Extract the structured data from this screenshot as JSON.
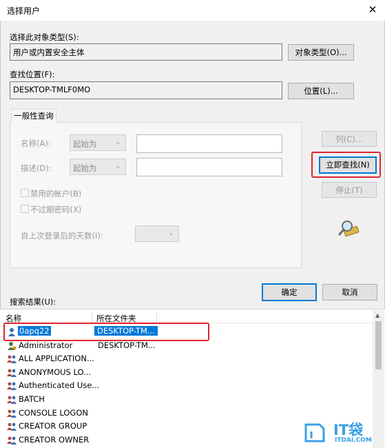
{
  "window": {
    "title": "选择用户",
    "close_glyph": "✕"
  },
  "object_type": {
    "label": "选择此对象类型(S):",
    "value": "用户或内置安全主体",
    "button": "对象类型(O)..."
  },
  "location": {
    "label": "查找位置(F):",
    "value": "DESKTOP-TMLF0MO",
    "button": "位置(L)..."
  },
  "tab": {
    "label": "一般性查询"
  },
  "query": {
    "name_label": "名称(A):",
    "name_combo": "起始为",
    "desc_label": "描述(D):",
    "desc_combo": "起始为",
    "disabled_accounts": "禁用的帐户(B)",
    "non_expiring_password": "不过期密码(X)",
    "days_since_logon": "自上次登录后的天数(I):"
  },
  "side_buttons": {
    "columns": "列(C)...",
    "find_now": "立即查找(N)",
    "stop": "停止(T)"
  },
  "dialog_buttons": {
    "ok": "确定",
    "cancel": "取消"
  },
  "results": {
    "label": "搜索结果(U):",
    "columns": [
      "名称",
      "所在文件夹"
    ],
    "rows": [
      {
        "name": "0apq22",
        "folder": "DESKTOP-TM...",
        "icon": "user-icon",
        "selected": true
      },
      {
        "name": "Administrator",
        "folder": "DESKTOP-TM...",
        "icon": "admin-user-icon"
      },
      {
        "name": "ALL APPLICATION...",
        "folder": "",
        "icon": "group-icon"
      },
      {
        "name": "ANONYMOUS LO...",
        "folder": "",
        "icon": "group-icon"
      },
      {
        "name": "Authenticated Use...",
        "folder": "",
        "icon": "group-icon"
      },
      {
        "name": "BATCH",
        "folder": "",
        "icon": "group-icon"
      },
      {
        "name": "CONSOLE LOGON",
        "folder": "",
        "icon": "group-icon"
      },
      {
        "name": "CREATOR GROUP",
        "folder": "",
        "icon": "group-icon"
      },
      {
        "name": "CREATOR OWNER",
        "folder": "",
        "icon": "group-icon"
      }
    ]
  },
  "watermark": {
    "brand": "IT袋",
    "url": "ITDAI.COM"
  },
  "colors": {
    "highlight": "#e0232e",
    "selection": "#0078d7",
    "brand": "#3aa0e6"
  }
}
